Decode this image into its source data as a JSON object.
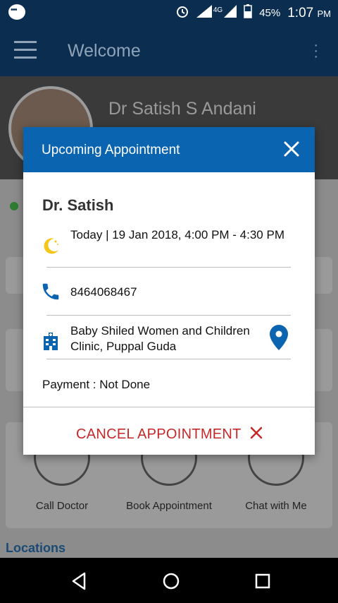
{
  "status_bar": {
    "network": "4G",
    "battery": "45%",
    "time": "1:07",
    "meridiem": "PM"
  },
  "app_bar": {
    "title": "Welcome"
  },
  "background": {
    "doctor_name": "Dr Satish S Andani",
    "quick_actions": [
      "Call Doctor",
      "Book Appointment",
      "Chat with Me"
    ],
    "locations_label": "Locations"
  },
  "dialog": {
    "title": "Upcoming Appointment",
    "doctor": "Dr. Satish",
    "datetime": "Today | 19 Jan 2018, 4:00 PM - 4:30 PM",
    "phone": "8464068467",
    "clinic": "Baby Shiled Women and Children Clinic, Puppal Guda",
    "payment": "Payment : Not Done",
    "cancel_label": "CANCEL APPOINTMENT"
  },
  "colors": {
    "primary": "#0b2d4f",
    "dialog_header": "#0b64b0",
    "cancel": "#c62828"
  }
}
